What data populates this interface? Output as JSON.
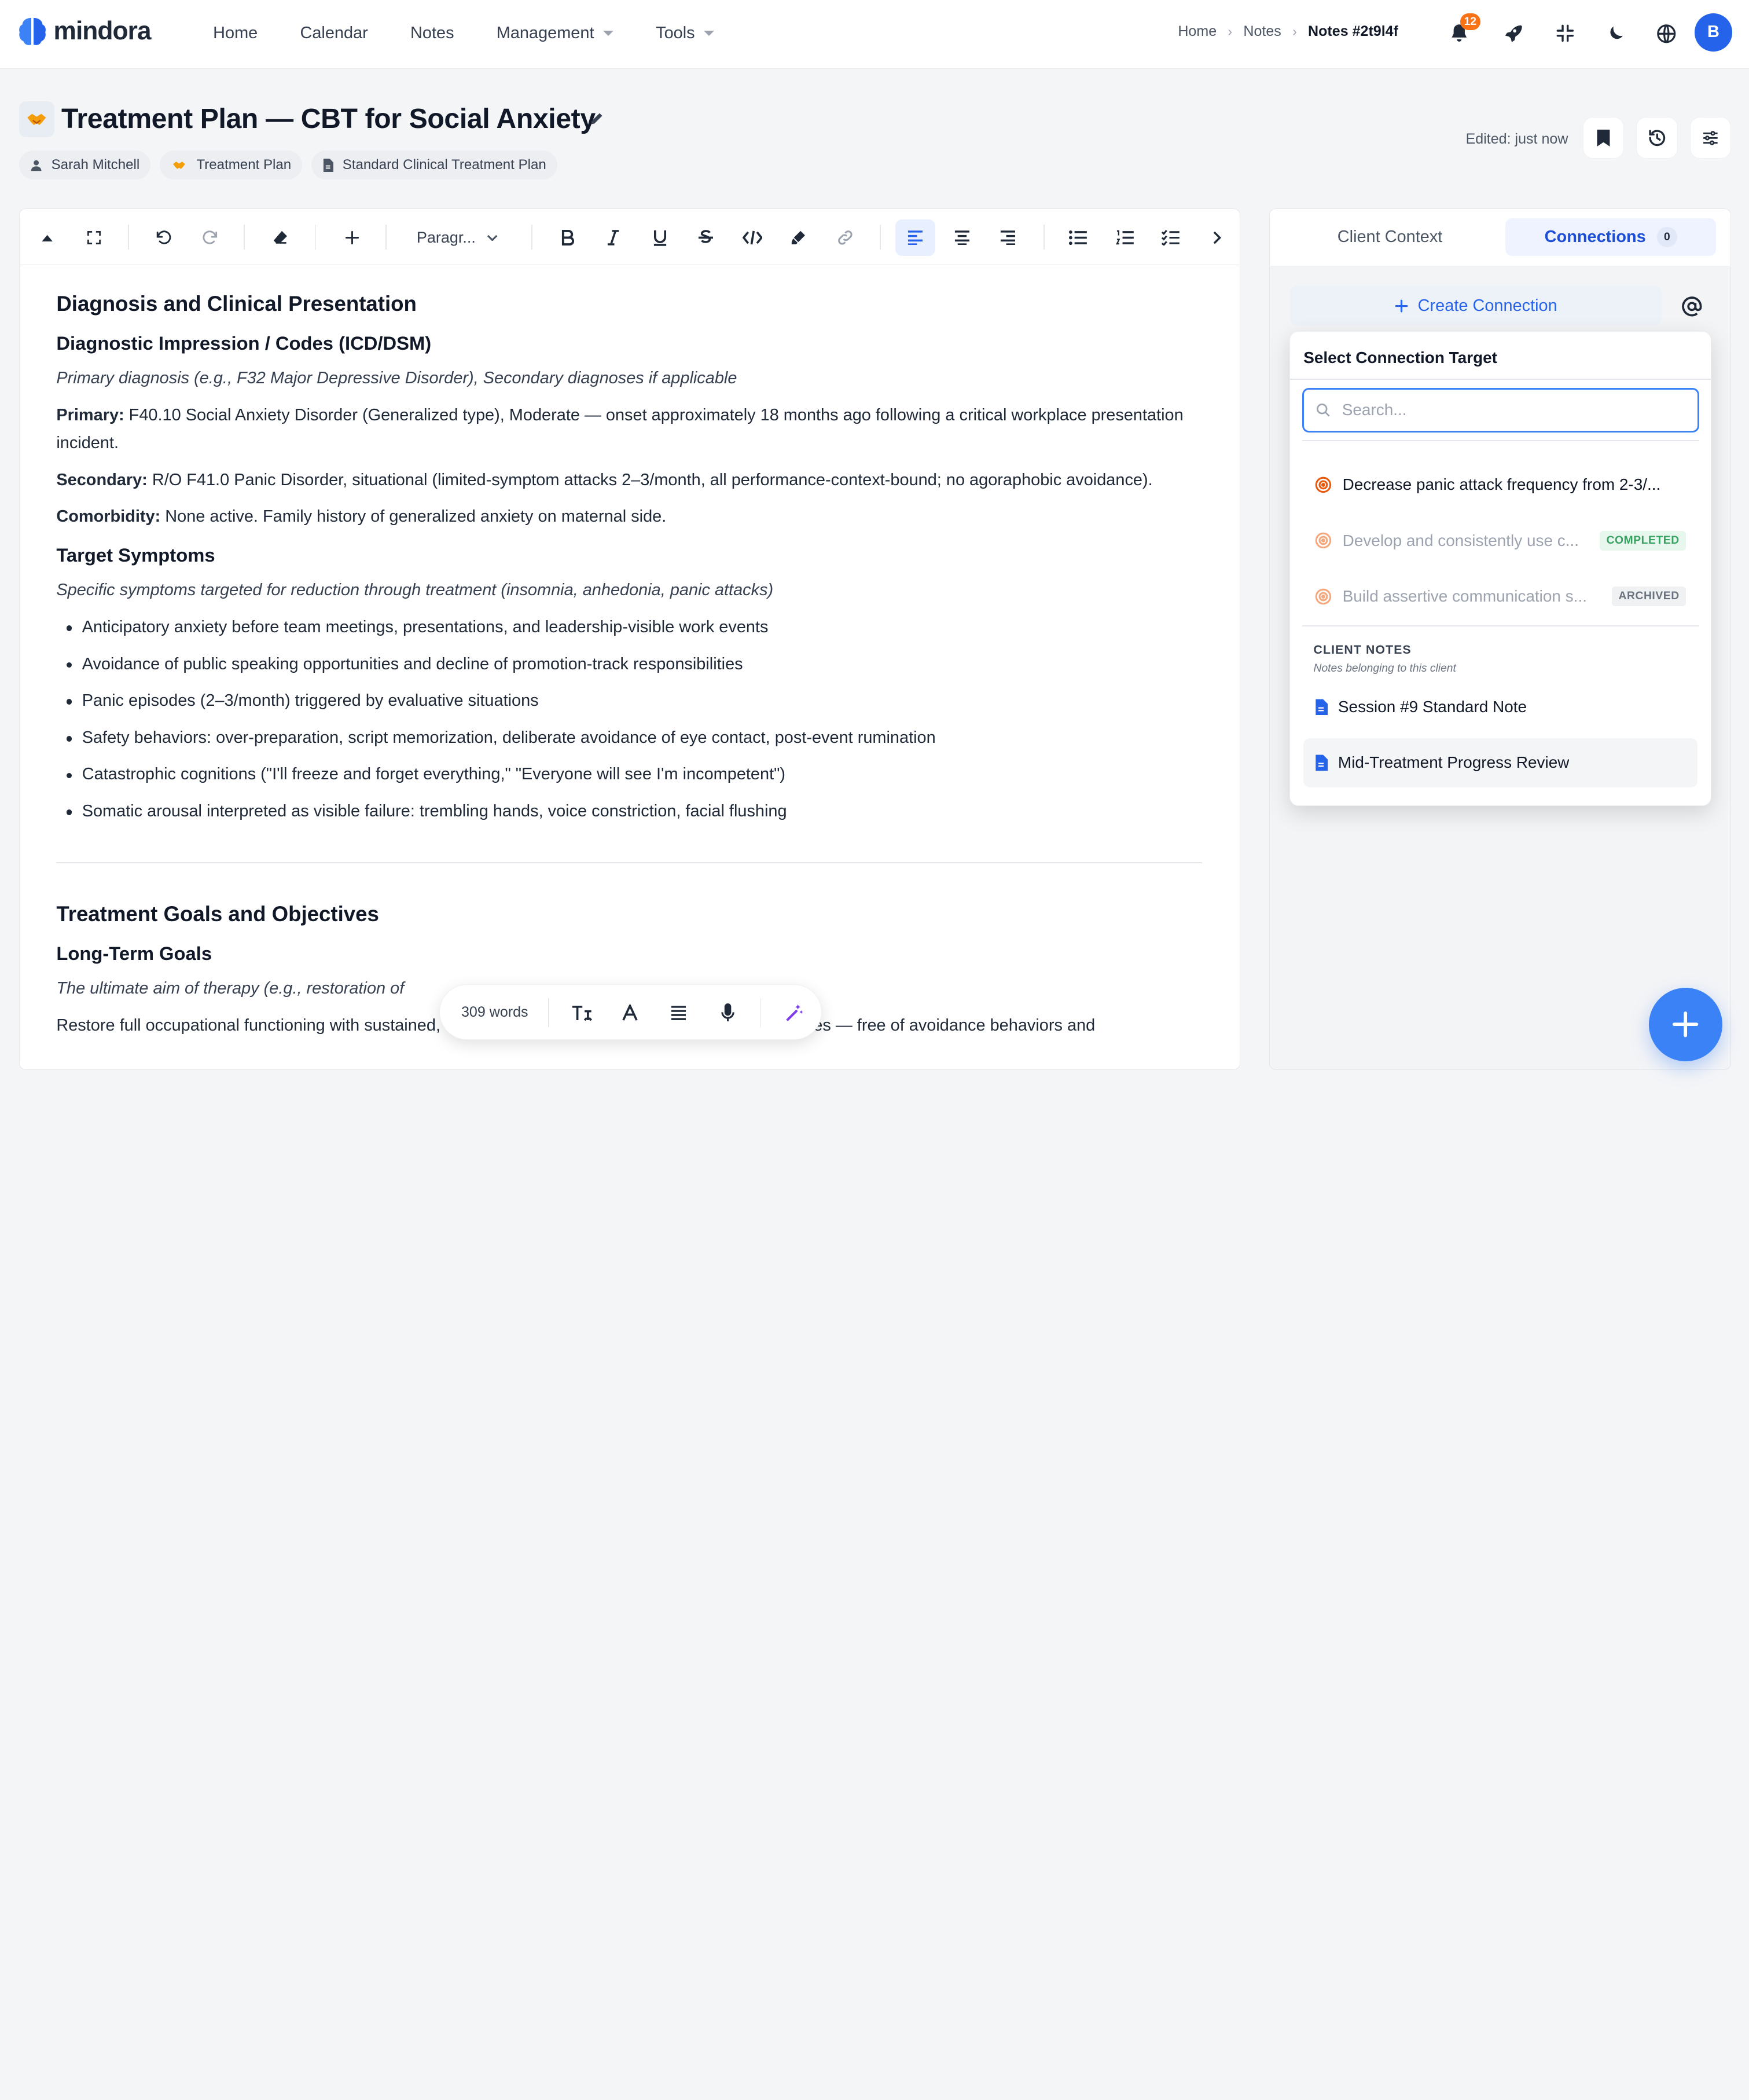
{
  "app": {
    "name": "mindora"
  },
  "nav": {
    "menu": [
      {
        "label": "Home"
      },
      {
        "label": "Calendar"
      },
      {
        "label": "Notes"
      },
      {
        "label": "Management"
      },
      {
        "label": "Tools"
      }
    ],
    "breadcrumb": [
      "Home",
      "Notes",
      "Notes #2t9l4f"
    ],
    "notification_count": "12",
    "avatar_initial": "B"
  },
  "page": {
    "title_emoji": "🤝",
    "title": "Treatment Plan — CBT for Social Anxiety",
    "chips": [
      {
        "icon": "person-icon",
        "label": "Sarah Mitchell"
      },
      {
        "icon": "handshake-icon",
        "label": "Treatment Plan"
      },
      {
        "icon": "document-icon",
        "label": "Standard Clinical Treatment Plan"
      }
    ],
    "edited": "Edited: just now"
  },
  "toolbar": {
    "paragraph_label": "Paragr..."
  },
  "document": {
    "h2_diagnosis": "Diagnosis and Clinical Presentation",
    "h3_impression": "Diagnostic Impression / Codes (ICD/DSM)",
    "impression_hint": "Primary diagnosis (e.g., F32 Major Depressive Disorder), Secondary diagnoses if applicable",
    "primary_label": "Primary:",
    "primary_text": " F40.10 Social Anxiety Disorder (Generalized type), Moderate — onset approximately 18 months ago following a critical workplace presentation incident.",
    "secondary_label": "Secondary:",
    "secondary_text": " R/O F41.0 Panic Disorder, situational (limited-symptom attacks 2–3/month, all performance-context-bound; no agoraphobic avoidance).",
    "comorbidity_label": "Comorbidity:",
    "comorbidity_text": " None active. Family history of generalized anxiety on maternal side.",
    "h3_symptoms": "Target Symptoms",
    "symptoms_hint": "Specific symptoms targeted for reduction through treatment (insomnia, anhedonia, panic attacks)",
    "symptoms": [
      "Anticipatory anxiety before team meetings, presentations, and leadership-visible work events",
      "Avoidance of public speaking opportunities and decline of promotion-track responsibilities",
      "Panic episodes (2–3/month) triggered by evaluative situations",
      "Safety behaviors: over-preparation, script memorization, deliberate avoidance of eye contact, post-event rumination",
      "Catastrophic cognitions (\"I'll freeze and forget everything,\" \"Everyone will see I'm incompetent\")",
      "Somatic arousal interpreted as visible failure: trembling hands, voice constriction, facial flushing"
    ],
    "h2_goals": "Treatment Goals and Objectives",
    "h3_long_term": "Long-Term Goals",
    "long_term_hint": "The ultimate aim of therapy (e.g., restoration of",
    "long_term_text": "Restore full occupational functioning with sustained, voluntary engagement in leadership-visible activities — free of avoidance behaviors and"
  },
  "float_toolbar": {
    "word_count": "309 words"
  },
  "panel": {
    "tabs": [
      {
        "label": "Client Context"
      },
      {
        "label": "Connections",
        "count": "0"
      }
    ],
    "create_connection": "Create Connection",
    "dropdown": {
      "title": "Select Connection Target",
      "search_placeholder": "Search...",
      "goals": [
        {
          "label": "Decrease panic attack frequency from 2-3/...",
          "status": ""
        },
        {
          "label": "Develop and consistently use c...",
          "status": "COMPLETED"
        },
        {
          "label": "Build assertive communication s...",
          "status": "ARCHIVED"
        }
      ],
      "section_title": "CLIENT NOTES",
      "section_subtitle": "Notes belonging to this client",
      "notes": [
        {
          "label": "Session #9 Standard Note"
        },
        {
          "label": "Mid-Treatment Progress Review"
        }
      ]
    }
  },
  "colors": {
    "accent": "#2563eb",
    "fab": "#3b82f6",
    "notification": "#f97316",
    "goal_icon": "#ea580c"
  }
}
